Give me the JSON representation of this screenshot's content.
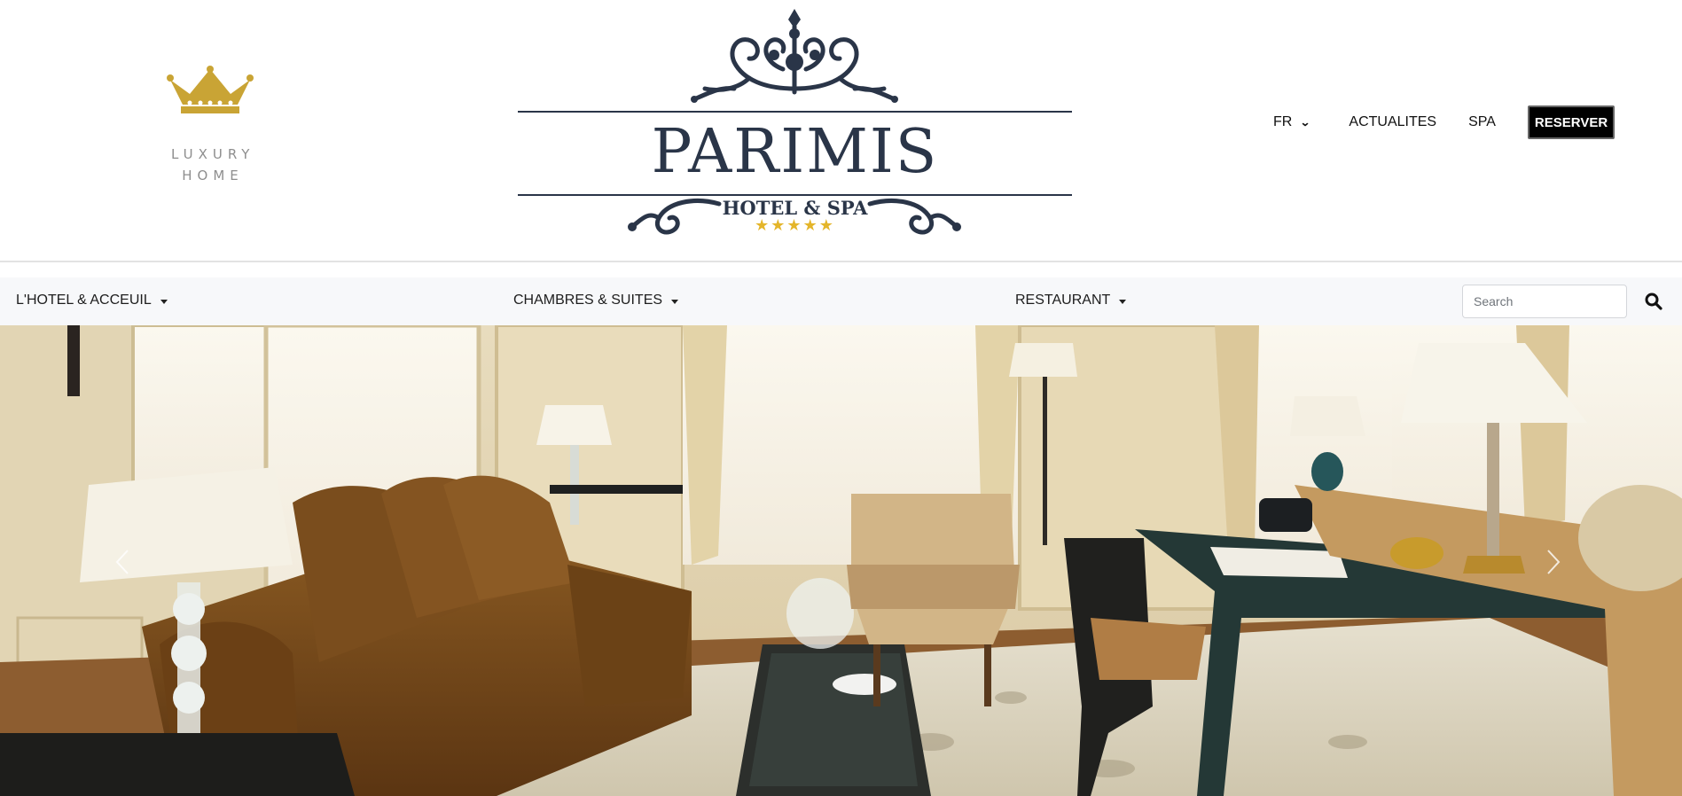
{
  "header": {
    "luxury_logo": {
      "icon": "crown-icon",
      "line1": "LUXURY",
      "line2": "HOME",
      "color": "#c9a435"
    },
    "main_logo": {
      "title": "PARIMIS",
      "subtitle": "HOTEL & SPA",
      "stars": "★★★★★",
      "color": "#2a3548",
      "star_color": "#e4b52a"
    },
    "top_nav": {
      "language": "FR",
      "links": [
        "ACTUALITES",
        "SPA"
      ],
      "reserve_label": "RESERVER"
    }
  },
  "main_nav": {
    "items": [
      "L'HOTEL & ACCEUIL",
      "CHAMBRES & SUITES",
      "RESTAURANT"
    ],
    "search_placeholder": "Search",
    "search_icon": "search-icon"
  },
  "hero": {
    "image": "luxury-suite-living-room-photo",
    "prev_icon": "chevron-left-icon",
    "next_icon": "chevron-right-icon"
  }
}
